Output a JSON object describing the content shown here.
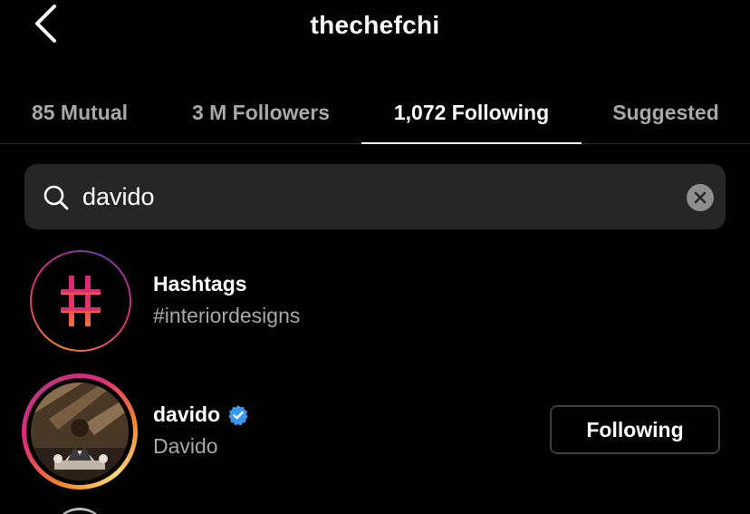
{
  "header": {
    "title": "thechefchi",
    "back_icon": "chevron-left-icon"
  },
  "tabs": [
    {
      "label": "85 Mutual",
      "active": false
    },
    {
      "label": "3 M Followers",
      "active": false
    },
    {
      "label": "1,072 Following",
      "active": true
    },
    {
      "label": "Suggested",
      "active": false
    }
  ],
  "search": {
    "value": "davido",
    "search_icon": "search-icon",
    "clear_icon": "clear-icon"
  },
  "results": [
    {
      "type": "hashtag",
      "title": "Hashtags",
      "subtitle": "#interiordesigns",
      "icon": "hashtag-icon"
    },
    {
      "type": "user",
      "username": "davido",
      "full_name": "Davido",
      "verified": true,
      "button_label": "Following"
    }
  ],
  "colors": {
    "background": "#000000",
    "search_bg": "#262626",
    "muted_text": "#a8a8a8",
    "verified_blue": "#3897f0"
  }
}
